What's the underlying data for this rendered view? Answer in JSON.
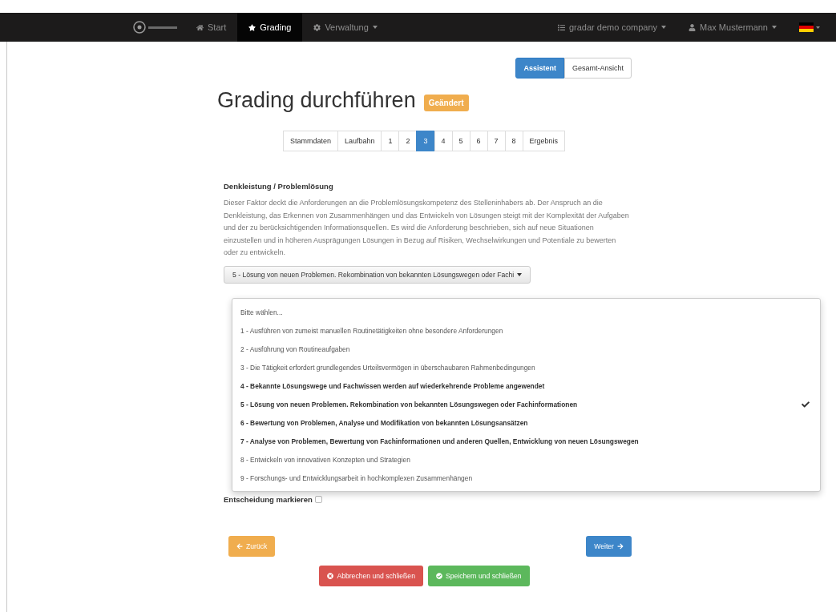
{
  "navbar": {
    "left": [
      {
        "label": "Start",
        "selected": false,
        "dropdown": false
      },
      {
        "label": "Grading",
        "selected": true,
        "dropdown": false
      },
      {
        "label": "Verwaltung",
        "selected": false,
        "dropdown": true
      }
    ],
    "right": [
      {
        "label": "gradar demo company",
        "dropdown": true
      },
      {
        "label": "Max Mustermann",
        "dropdown": true
      }
    ]
  },
  "view_toggle": [
    {
      "label": "Assistent",
      "selected": true
    },
    {
      "label": "Gesamt-Ansicht",
      "selected": false
    }
  ],
  "title": "Grading durchführen",
  "status_badge": "Geändert",
  "steps": [
    {
      "label": "Stammdaten",
      "selected": false
    },
    {
      "label": "Laufbahn",
      "selected": false
    },
    {
      "label": "1",
      "selected": false
    },
    {
      "label": "2",
      "selected": false
    },
    {
      "label": "3",
      "selected": true
    },
    {
      "label": "4",
      "selected": false
    },
    {
      "label": "5",
      "selected": false
    },
    {
      "label": "6",
      "selected": false
    },
    {
      "label": "7",
      "selected": false
    },
    {
      "label": "8",
      "selected": false
    },
    {
      "label": "Ergebnis",
      "selected": false
    }
  ],
  "section": {
    "heading": "Denkleistung / Problemlösung",
    "description": "Dieser Faktor deckt die Anforderungen an die Problemlösungskompetenz des Stelleninhabers ab. Der Anspruch an die Denkleistung, das Erkennen von Zusammenhängen und das Entwickeln von Lösungen steigt mit der Komplexität der Aufgaben und der zu berücksichtigenden Informationsquellen. Es wird die Anforderung beschrieben, sich auf neue Situationen einzustellen und in höheren Ausprägungen Lösungen in Bezug auf Risiken, Wechselwirkungen und Potentiale zu bewerten oder zu entwickeln.",
    "select_value": "5 - Lösung von neuen Problemen. Rekombination von bekannten Lösungswegen oder Fachi",
    "options": [
      {
        "label": "Bitte wählen...",
        "bold": false,
        "selected": false
      },
      {
        "label": "1 - Ausführen von zumeist manuellen Routinetätigkeiten ohne besondere Anforderungen",
        "bold": false,
        "selected": false
      },
      {
        "label": "2 - Ausführung von Routineaufgaben",
        "bold": false,
        "selected": false
      },
      {
        "label": "3 - Die Tätigkeit erfordert grundlegendes Urteilsvermögen in überschaubaren Rahmenbedingungen",
        "bold": false,
        "selected": false
      },
      {
        "label": "4 - Bekannte Lösungswege und Fachwissen werden auf wiederkehrende Probleme angewendet",
        "bold": true,
        "selected": false
      },
      {
        "label": "5 - Lösung von neuen Problemen. Rekombination von bekannten Lösungswegen oder Fachinformationen",
        "bold": true,
        "selected": true
      },
      {
        "label": "6 - Bewertung von Problemen, Analyse und Modifikation von bekannten Lösungsansätzen",
        "bold": true,
        "selected": false
      },
      {
        "label": "7 - Analyse von Problemen, Bewertung von Fachinformationen und anderen Quellen, Entwicklung von neuen Lösungswegen",
        "bold": true,
        "selected": false
      },
      {
        "label": "8 - Entwickeln von innovativen Konzepten und Strategien",
        "bold": false,
        "selected": false
      },
      {
        "label": "9 - Forschungs- und Entwicklungsarbeit in hochkomplexen Zusammenhängen",
        "bold": false,
        "selected": false
      }
    ]
  },
  "mark_decision": {
    "label": "Entscheidung markieren",
    "checked": false
  },
  "nav_buttons": {
    "back": "Zurück",
    "next": "Weiter"
  },
  "actions": [
    {
      "label": "Abbrechen und schließen",
      "kind": "danger"
    },
    {
      "label": "Speichern und schließen",
      "kind": "success"
    }
  ]
}
